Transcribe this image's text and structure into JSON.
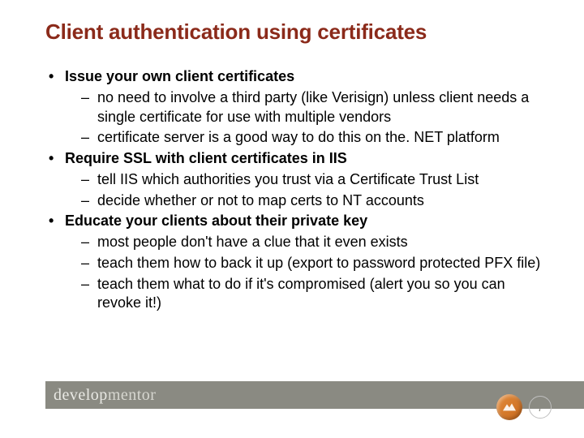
{
  "slide": {
    "title": "Client authentication using certificates",
    "bullets": [
      {
        "label": "Issue your own client certificates",
        "subs": [
          "no need to involve a third party (like Verisign) unless client needs a single certificate for use with multiple vendors",
          "certificate server is a good way to do this on the. NET platform"
        ]
      },
      {
        "label": "Require SSL with client certificates in IIS",
        "subs": [
          "tell IIS which authorities you trust via a Certificate Trust List",
          "decide whether or not to map certs to NT accounts"
        ]
      },
      {
        "label": "Educate your clients about their private key",
        "subs": [
          "most people don't have a clue that it even exists",
          "teach them how to back it up (export to password protected PFX file)",
          "teach them what to do if it's compromised (alert you so you can revoke it!)"
        ]
      }
    ]
  },
  "footer": {
    "brand_a": "develop",
    "brand_b": "mentor",
    "page_number": "7"
  }
}
